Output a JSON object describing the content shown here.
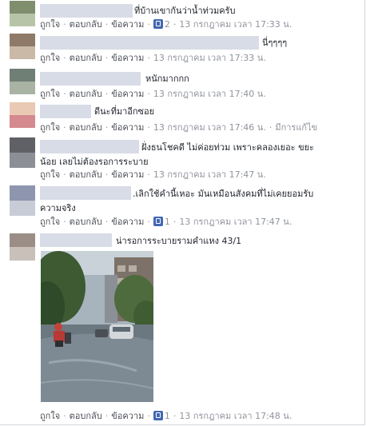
{
  "actions": {
    "like": "ถูกใจ",
    "reply": "ตอบกลับ",
    "message": "ข้อความ"
  },
  "colors": {
    "text": "#1d2129",
    "meta": "#90949c",
    "link": "#4b4f56",
    "like_badge": "#4267b2",
    "name_blur": "#d8dce6"
  },
  "comments": [
    {
      "text": "ที่บ้านเขากันว่าน้ำท่วมครับ",
      "likes": "2",
      "time": "13 กรกฎาคม เวลา 17:33 น."
    },
    {
      "text": "นี่ๆๆๆๆ",
      "likes": "",
      "time": "13 กรกฎาคม เวลา 17:33 น."
    },
    {
      "text": "หนักมากกก",
      "likes": "",
      "time": "13 กรกฎาคม เวลา 17:40 น."
    },
    {
      "text": "ดีนะที่มาอีกซอย",
      "likes": "",
      "time": "13 กรกฎาคม เวลา 17:46 น.",
      "edited": "มีการแก้ไข"
    },
    {
      "text_line1": "ฝั่งธนโชคดี ไม่ค่อยท่วม เพราะคลองเยอะ ขยะ",
      "text_line2": "น้อย เลยไม่ต้องรอการระบาย",
      "likes": "",
      "time": "13 กรกฎาคม เวลา 17:47 น."
    },
    {
      "text_line1": ".เลิกใช้คำนี้เหอะ มันเหมือนสังคมที่ไม่เคยยอมรับ",
      "text_line2": "ความจริง",
      "likes": "1",
      "time": "13 กรกฎาคม เวลา 17:47 น."
    },
    {
      "text": "น่ารอการระบายรามคำแหง 43/1",
      "likes": "1",
      "time": "13 กรกฎาคม เวลา 17:48 น.",
      "photo": "flooded street with motorcycles and car"
    }
  ]
}
